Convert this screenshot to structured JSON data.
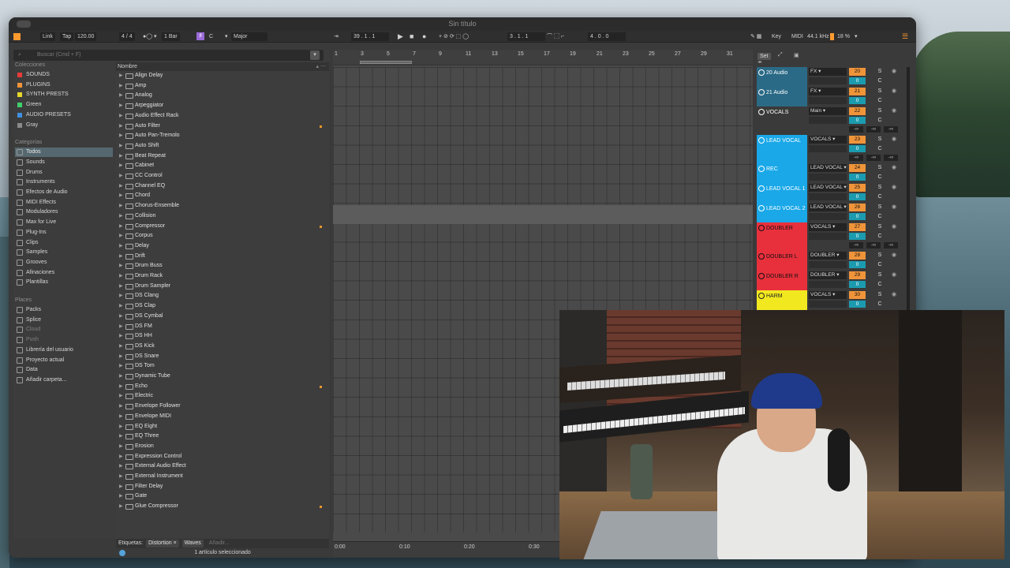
{
  "window": {
    "title": "Sin título"
  },
  "controlbar": {
    "link": "Link",
    "tap": "Tap",
    "tempo": "120.00",
    "time_sig_num": "4",
    "time_sig_sep": "/",
    "time_sig_den": "4",
    "metro": "1 Bar",
    "key_root": "C",
    "key_scale": "Major",
    "position": "39 .  1 .  1",
    "loop_start": "3 .  1 .  1",
    "loop_len": "4 .  0 .  0",
    "key_label": "Key",
    "midi_label": "MIDI",
    "sample_rate": "44.1 kHz",
    "cpu": "18 %"
  },
  "browser": {
    "search_placeholder": "Buscar (Cmd + F)",
    "collections_title": "Colecciones",
    "collections": [
      {
        "label": "SOUNDS",
        "color": "#e83a3a"
      },
      {
        "label": "PLUGINS",
        "color": "#f0943a"
      },
      {
        "label": "SYNTH PRESTS",
        "color": "#e6d82a"
      },
      {
        "label": "Green",
        "color": "#3fcf6b"
      },
      {
        "label": "AUDIO PRESETS",
        "color": "#3f8fe0"
      },
      {
        "label": "Gray",
        "color": "#8a8a8a"
      }
    ],
    "categories_title": "Categorías",
    "categories": [
      "Todos",
      "Sounds",
      "Drums",
      "Instruments",
      "Efectos de Audio",
      "MIDI Effects",
      "Moduladores",
      "Max for Live",
      "Plug-Ins",
      "Clips",
      "Samples",
      "Grooves",
      "Afinaciones",
      "Plantillas"
    ],
    "places_title": "Places",
    "places": [
      "Packs",
      "Splice",
      "Cloud",
      "Push",
      "Librería del usuario",
      "Proyecto actual",
      "Data",
      "Añadir carpeta..."
    ],
    "list_header": "Nombre",
    "items": [
      {
        "label": "Align Delay",
        "mark": false
      },
      {
        "label": "Amp",
        "mark": false
      },
      {
        "label": "Analog",
        "mark": false
      },
      {
        "label": "Arpeggiator",
        "mark": false
      },
      {
        "label": "Audio Effect Rack",
        "mark": false
      },
      {
        "label": "Auto Filter",
        "mark": true
      },
      {
        "label": "Auto Pan-Tremolo",
        "mark": false
      },
      {
        "label": "Auto Shift",
        "mark": false
      },
      {
        "label": "Beat Repeat",
        "mark": false
      },
      {
        "label": "Cabinet",
        "mark": false
      },
      {
        "label": "CC Control",
        "mark": false
      },
      {
        "label": "Channel EQ",
        "mark": false
      },
      {
        "label": "Chord",
        "mark": false
      },
      {
        "label": "Chorus-Ensemble",
        "mark": false
      },
      {
        "label": "Collision",
        "mark": false
      },
      {
        "label": "Compressor",
        "mark": true
      },
      {
        "label": "Corpus",
        "mark": false
      },
      {
        "label": "Delay",
        "mark": false
      },
      {
        "label": "Drift",
        "mark": false
      },
      {
        "label": "Drum Buss",
        "mark": false
      },
      {
        "label": "Drum Rack",
        "mark": false
      },
      {
        "label": "Drum Sampler",
        "mark": false
      },
      {
        "label": "DS Clang",
        "mark": false
      },
      {
        "label": "DS Clap",
        "mark": false
      },
      {
        "label": "DS Cymbal",
        "mark": false
      },
      {
        "label": "DS FM",
        "mark": false
      },
      {
        "label": "DS HH",
        "mark": false
      },
      {
        "label": "DS Kick",
        "mark": false
      },
      {
        "label": "DS Snare",
        "mark": false
      },
      {
        "label": "DS Tom",
        "mark": false
      },
      {
        "label": "Dynamic Tube",
        "mark": false
      },
      {
        "label": "Echo",
        "mark": true
      },
      {
        "label": "Electric",
        "mark": false
      },
      {
        "label": "Envelope Follower",
        "mark": false
      },
      {
        "label": "Envelope MIDI",
        "mark": false
      },
      {
        "label": "EQ Eight",
        "mark": false
      },
      {
        "label": "EQ Three",
        "mark": false
      },
      {
        "label": "Erosion",
        "mark": false
      },
      {
        "label": "Expression Control",
        "mark": false
      },
      {
        "label": "External Audio Effect",
        "mark": false
      },
      {
        "label": "External Instrument",
        "mark": false
      },
      {
        "label": "Filter Delay",
        "mark": false
      },
      {
        "label": "Gate",
        "mark": false
      },
      {
        "label": "Glue Compressor",
        "mark": true
      }
    ],
    "tags_label": "Etiquetas:",
    "tags": [
      "Distortion ×",
      "Waves"
    ],
    "tags_add": "Añadir...",
    "status": "1 artículo seleccionado"
  },
  "arrangement": {
    "ruler": [
      "1",
      "3",
      "5",
      "7",
      "9",
      "11",
      "13",
      "15",
      "17",
      "19",
      "21",
      "23",
      "25",
      "27",
      "29",
      "31"
    ],
    "time_ruler": [
      "0:00",
      "0:10",
      "0:20",
      "0:30"
    ]
  },
  "mixer": {
    "set_label": "Set",
    "tracks": [
      {
        "name": "20 Audio",
        "color": "#2a6a86",
        "route": "FX",
        "num": "20",
        "vol": "0",
        "icon": "▾"
      },
      {
        "name": "21 Audio",
        "color": "#2a6a86",
        "route": "FX",
        "num": "21",
        "vol": "0",
        "icon": "▾"
      },
      {
        "name": "VOCALS",
        "color": "#3a3a3a",
        "route": "Main",
        "num": "22",
        "vol": "0",
        "icon": "§",
        "inf": true
      },
      {
        "name": "LEAD VOCAL",
        "color": "#1aa8e8",
        "route": "VOCALS",
        "num": "23",
        "vol": "0",
        "icon": "§",
        "inf": true
      },
      {
        "name": "REC",
        "color": "#1aa8e8",
        "route": "LEAD VOCAL",
        "num": "24",
        "vol": "0",
        "icon": "▾"
      },
      {
        "name": "LEAD VOCAL 1",
        "color": "#1aa8e8",
        "route": "LEAD VOCAL",
        "num": "25",
        "vol": "0",
        "icon": "▾"
      },
      {
        "name": "LEAD VOCAL 2",
        "color": "#1aa8e8",
        "route": "LEAD VOCAL",
        "num": "26",
        "vol": "0",
        "icon": "▾"
      },
      {
        "name": "DOUBLER",
        "color": "#e8303c",
        "route": "VOCALS",
        "num": "27",
        "vol": "0",
        "icon": "§",
        "inf": true
      },
      {
        "name": "DOUBLER L",
        "color": "#e8303c",
        "route": "DOUBLER",
        "num": "28",
        "vol": "0",
        "icon": "▾"
      },
      {
        "name": "DOUBLER R",
        "color": "#e8303c",
        "route": "DOUBLER",
        "num": "29",
        "vol": "0",
        "icon": "▾"
      },
      {
        "name": "HARM",
        "color": "#f2e820",
        "route": "VOCALS",
        "num": "30",
        "vol": "0",
        "icon": "§"
      }
    ],
    "solo": "S",
    "center": "C",
    "inf": "-∞"
  }
}
